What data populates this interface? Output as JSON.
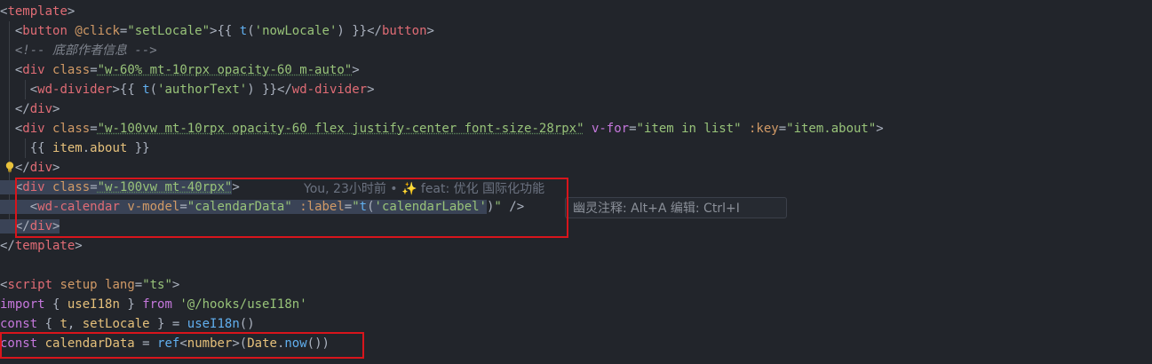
{
  "editor": {
    "lines": [
      [
        "<",
        "template",
        ">"
      ],
      [
        "  <",
        "button",
        " ",
        "@click",
        "=",
        "\"setLocale\"",
        ">",
        "{{ ",
        "t",
        "(",
        "'nowLocale'",
        ") }}",
        "</",
        "button",
        ">"
      ],
      [
        "  <!-- 底部作者信息 -->"
      ],
      [
        "  <",
        "div",
        " ",
        "class",
        "=",
        "\"w-60% mt-10rpx opacity-60 m-auto\"",
        ">"
      ],
      [
        "    <",
        "wd-divider",
        ">",
        "{{ ",
        "t",
        "(",
        "'authorText'",
        ") }}",
        "</",
        "wd-divider",
        ">"
      ],
      [
        "  </",
        "div",
        ">"
      ],
      [
        "  <",
        "div",
        " ",
        "class",
        "=",
        "\"w-100vw mt-10rpx opacity-60 flex justify-center font-size-28rpx\"",
        " ",
        "v-for",
        "=",
        "\"item in list\"",
        " ",
        ":key",
        "=",
        "\"item.about\"",
        ">"
      ],
      [
        "    {{ ",
        "item",
        ".",
        "about",
        " }}"
      ],
      [
        "  </",
        "div",
        ">"
      ],
      [
        "  <",
        "div",
        " ",
        "class",
        "=",
        "\"w-100vw mt-40rpx\"",
        ">"
      ],
      [
        "    <",
        "wd-calendar",
        " ",
        "v-model",
        "=",
        "\"calendarData\"",
        " ",
        ":label",
        "=",
        "\"",
        "t",
        "(",
        "'calendarLabel'",
        ")",
        "\"",
        " />"
      ],
      [
        "  </",
        "div",
        ">"
      ],
      [
        "</",
        "template",
        ">"
      ],
      [
        ""
      ],
      [
        "<",
        "script",
        " ",
        "setup",
        " ",
        "lang",
        "=",
        "\"ts\"",
        ">"
      ],
      [
        "import",
        " { ",
        "useI18n",
        " } ",
        "from",
        " ",
        "'@/hooks/useI18n'"
      ],
      [
        "const",
        " { ",
        "t",
        ", ",
        "setLocale",
        " } = ",
        "useI18n",
        "()"
      ],
      [
        "const",
        " ",
        "calendarData",
        " = ",
        "ref",
        "<",
        "number",
        ">(",
        "Date",
        ".",
        "now",
        "())"
      ]
    ],
    "blame": "You, 23小时前 • ✨ feat: 优化 国际化功能",
    "hint": "幽灵注释: Alt+A 编辑: Ctrl+I"
  }
}
